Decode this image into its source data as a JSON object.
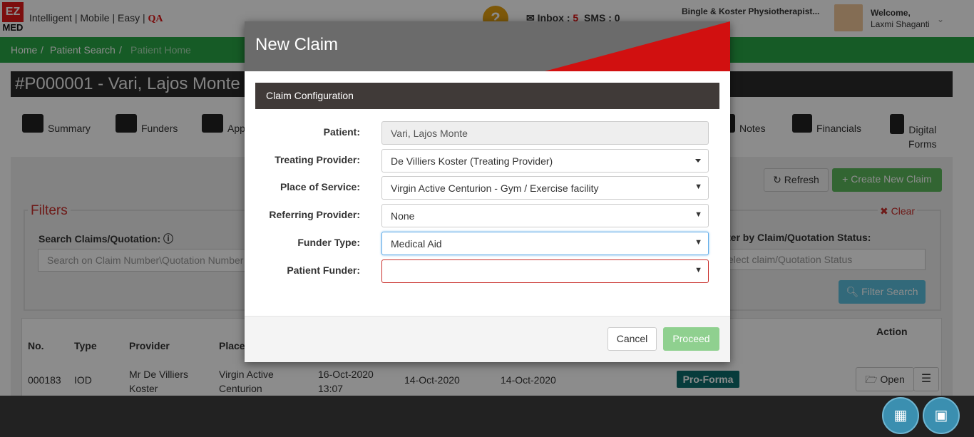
{
  "header": {
    "logo_top": "EZ",
    "logo_bottom": "MED",
    "tagline": "Intelligent | Mobile | Easy | ",
    "tagline_qa": "QA",
    "help_icon": "question-icon",
    "inbox_label": "Inbox : ",
    "inbox_count": "5",
    "sms_label": "SMS : 0",
    "practice_name": "Bingle & Koster Physiotherapist...",
    "welcome": "Welcome,",
    "user_name": "Laxmi Shaganti"
  },
  "breadcrumb": {
    "home": "Home",
    "patient_search": "Patient Search",
    "current": "Patient Home"
  },
  "patient_title": "#P000001 - Vari, Lajos Monte",
  "tabs": [
    {
      "label": "Summary"
    },
    {
      "label": "Funders"
    },
    {
      "label": "Appt"
    },
    {
      "label": "Notes"
    },
    {
      "label": "Financials"
    },
    {
      "label": "Digital"
    },
    {
      "label": "Forms"
    }
  ],
  "toolbar": {
    "refresh_label": "Refresh",
    "create_label": "Create New Claim"
  },
  "filters": {
    "title": "Filters",
    "clear_label": "Clear",
    "search_label": "Search Claims/Quotation:",
    "search_placeholder": "Search on Claim Number\\Quotation Number",
    "status_label": "ter by Claim/Quotation Status:",
    "status_placeholder": "elect claim/Quotation Status",
    "filter_button": "Filter Search"
  },
  "table": {
    "headers": {
      "no": "No.",
      "type": "Type",
      "provider": "Provider",
      "place": "Place",
      "action": "Action"
    },
    "row": {
      "no": "000183",
      "type": "IOD",
      "provider_1": "Mr De Villiers",
      "provider_2": "Koster",
      "place_1": "Virgin Active",
      "place_2": "Centurion",
      "date_1": "16-Oct-2020",
      "time_1": "13:07",
      "date_2": "14-Oct-2020",
      "date_3": "14-Oct-2020",
      "status": "Pro-Forma",
      "open_label": "Open"
    }
  },
  "modal": {
    "title": "New Claim",
    "section_title": "Claim Configuration",
    "fields": {
      "patient_label": "Patient:",
      "patient_value": "Vari, Lajos Monte",
      "treating_label": "Treating Provider:",
      "treating_value": "De Villiers Koster (Treating Provider)",
      "place_label": "Place of Service:",
      "place_value": "Virgin Active Centurion - Gym / Exercise facility",
      "referring_label": "Referring Provider:",
      "referring_value": "None",
      "funder_type_label": "Funder Type:",
      "funder_type_value": "Medical Aid",
      "patient_funder_label": "Patient Funder:",
      "patient_funder_value": ""
    },
    "cancel_label": "Cancel",
    "proceed_label": "Proceed"
  },
  "colors": {
    "brand_red": "#e21b1b",
    "breadcrumb_green": "#28a745",
    "modal_header": "#6b6b6b",
    "proceed_green": "#8fd08f"
  }
}
